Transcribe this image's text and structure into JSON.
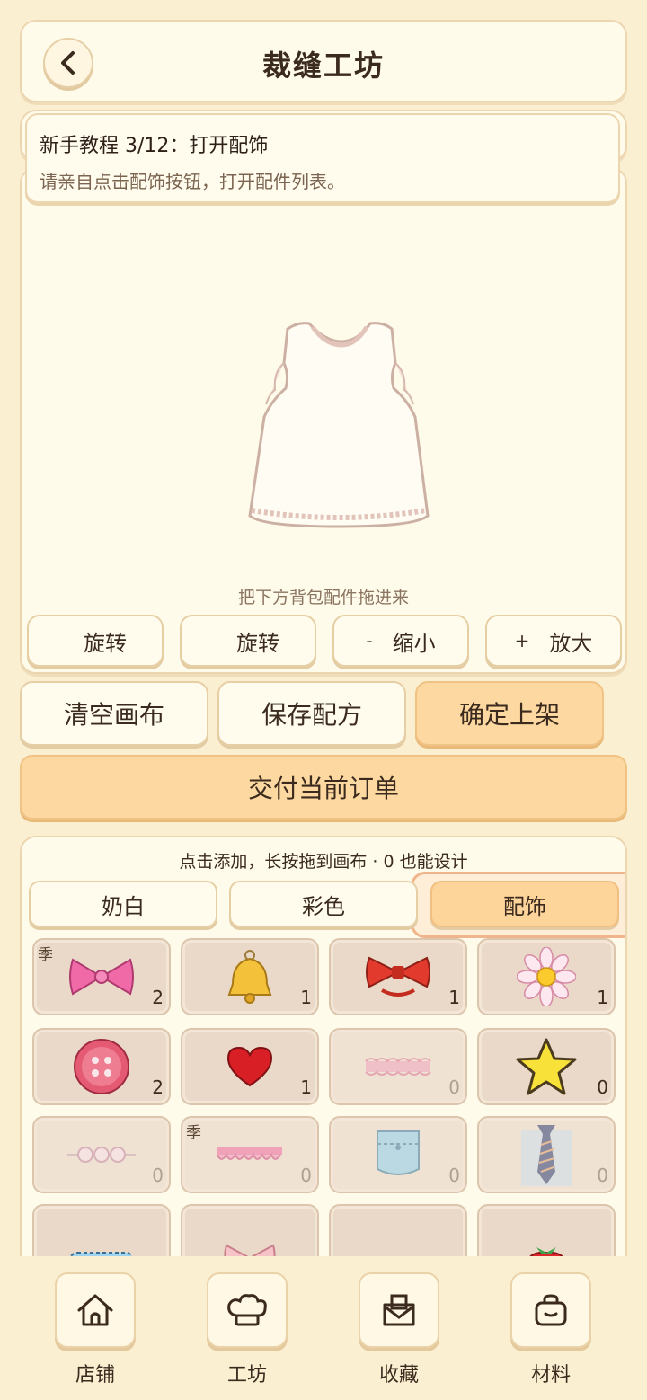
{
  "header": {
    "title": "裁缝工坊"
  },
  "tutorial": {
    "title": "新手教程 3/12：打开配饰",
    "body": "请亲自点击配饰按钮，打开配件列表。"
  },
  "canvas": {
    "drag_hint": "把下方背包配件拖进来",
    "tools": [
      {
        "label": "旋转",
        "icon": "rotate-left-icon",
        "glyph": ""
      },
      {
        "label": "旋转",
        "icon": "rotate-right-icon",
        "glyph": ""
      },
      {
        "label": "缩小",
        "icon": "zoom-out-icon",
        "glyph": "-"
      },
      {
        "label": "放大",
        "icon": "zoom-in-icon",
        "glyph": "+"
      }
    ]
  },
  "actions": {
    "clear": "清空画布",
    "save": "保存配方",
    "publish": "确定上架",
    "deliver": "交付当前订单"
  },
  "bag": {
    "hint": "点击添加，长按拖到画布 · 0 也能设计",
    "tabs": [
      "奶白",
      "彩色",
      "配饰"
    ],
    "active_tab": "配饰",
    "items": [
      {
        "icon": "pink-bow-icon",
        "count": "2",
        "season": "季"
      },
      {
        "icon": "golden-bell-icon",
        "count": "1",
        "season": ""
      },
      {
        "icon": "red-bow-collar-icon",
        "count": "1",
        "season": ""
      },
      {
        "icon": "daisy-flower-icon",
        "count": "1",
        "season": ""
      },
      {
        "icon": "pink-button-icon",
        "count": "2",
        "season": ""
      },
      {
        "icon": "red-heart-icon",
        "count": "1",
        "season": ""
      },
      {
        "icon": "lace-trim-icon",
        "count": "0",
        "season": ""
      },
      {
        "icon": "yellow-star-icon",
        "count": "0",
        "season": ""
      },
      {
        "icon": "pearl-chain-icon",
        "count": "0",
        "season": ""
      },
      {
        "icon": "ruffle-trim-icon",
        "count": "0",
        "season": "季"
      },
      {
        "icon": "denim-pocket-icon",
        "count": "0",
        "season": ""
      },
      {
        "icon": "striped-tie-icon",
        "count": "0",
        "season": ""
      },
      {
        "icon": "blue-patch-icon",
        "count": "",
        "season": ""
      },
      {
        "icon": "green-bow-icon",
        "count": "",
        "season": ""
      },
      {
        "icon": "blue-cloud-icon",
        "count": "",
        "season": ""
      },
      {
        "icon": "strawberry-icon",
        "count": "",
        "season": ""
      }
    ]
  },
  "nav": [
    {
      "label": "店铺",
      "icon": "home-icon"
    },
    {
      "label": "工坊",
      "icon": "chef-hat-icon"
    },
    {
      "label": "收藏",
      "icon": "mailbox-icon"
    },
    {
      "label": "材料",
      "icon": "bag-icon"
    }
  ],
  "colors": {
    "background": "#fbefd2",
    "panel": "#fffbea",
    "accent": "#fdd8a0",
    "border": "#ecd6b0"
  }
}
